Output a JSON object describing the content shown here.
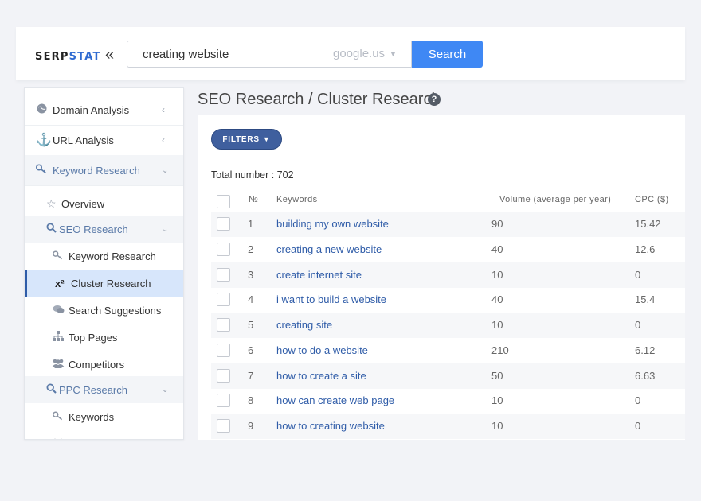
{
  "header": {
    "logo_main": "SERP",
    "logo_accent": "STAT",
    "collapse_glyph": "«",
    "search_value": "creating website",
    "engine_label": "google.us",
    "search_button": "Search"
  },
  "sidebar": {
    "items": [
      {
        "label": "Domain Analysis",
        "icon": "globe-icon"
      },
      {
        "label": "URL Analysis",
        "icon": "anchor-icon"
      },
      {
        "label": "Keyword Research",
        "icon": "key-icon"
      },
      {
        "label": "Overview",
        "icon": "star-icon"
      },
      {
        "label": "SEO Research",
        "icon": "search-icon"
      },
      {
        "label": "Keyword Research",
        "icon": "key-icon"
      },
      {
        "label": "Cluster Research",
        "icon": "x-squared-icon"
      },
      {
        "label": "Search Suggestions",
        "icon": "chat-icon"
      },
      {
        "label": "Top Pages",
        "icon": "sitemap-icon"
      },
      {
        "label": "Competitors",
        "icon": "users-icon"
      },
      {
        "label": "PPC Research",
        "icon": "search-icon"
      },
      {
        "label": "Keywords",
        "icon": "key-icon"
      }
    ]
  },
  "main": {
    "title": "SEO Research / Cluster Research",
    "filters_label": "FILTERS",
    "total_label": "Total number : 702",
    "columns": {
      "number": "№",
      "keywords": "Keywords",
      "volume": "Volume (average per year)",
      "cpc": "CPC ($)"
    },
    "rows": [
      {
        "n": "1",
        "keyword": "building my own website",
        "volume": "90",
        "cpc": "15.42"
      },
      {
        "n": "2",
        "keyword": "creating a new website",
        "volume": "40",
        "cpc": "12.6"
      },
      {
        "n": "3",
        "keyword": "create internet site",
        "volume": "10",
        "cpc": "0"
      },
      {
        "n": "4",
        "keyword": "i want to build a website",
        "volume": "40",
        "cpc": "15.4"
      },
      {
        "n": "5",
        "keyword": "creating site",
        "volume": "10",
        "cpc": "0"
      },
      {
        "n": "6",
        "keyword": "how to do a website",
        "volume": "210",
        "cpc": "6.12"
      },
      {
        "n": "7",
        "keyword": "how to create a site",
        "volume": "50",
        "cpc": "6.63"
      },
      {
        "n": "8",
        "keyword": "how can create web page",
        "volume": "10",
        "cpc": "0"
      },
      {
        "n": "9",
        "keyword": "how to creating website",
        "volume": "10",
        "cpc": "0"
      }
    ]
  },
  "colors": {
    "accent": "#3f88f4",
    "brand": "#2f6bd1",
    "filters": "#3f5f9e",
    "active_bg": "#d7e6fb",
    "link": "#2f5ca8"
  }
}
